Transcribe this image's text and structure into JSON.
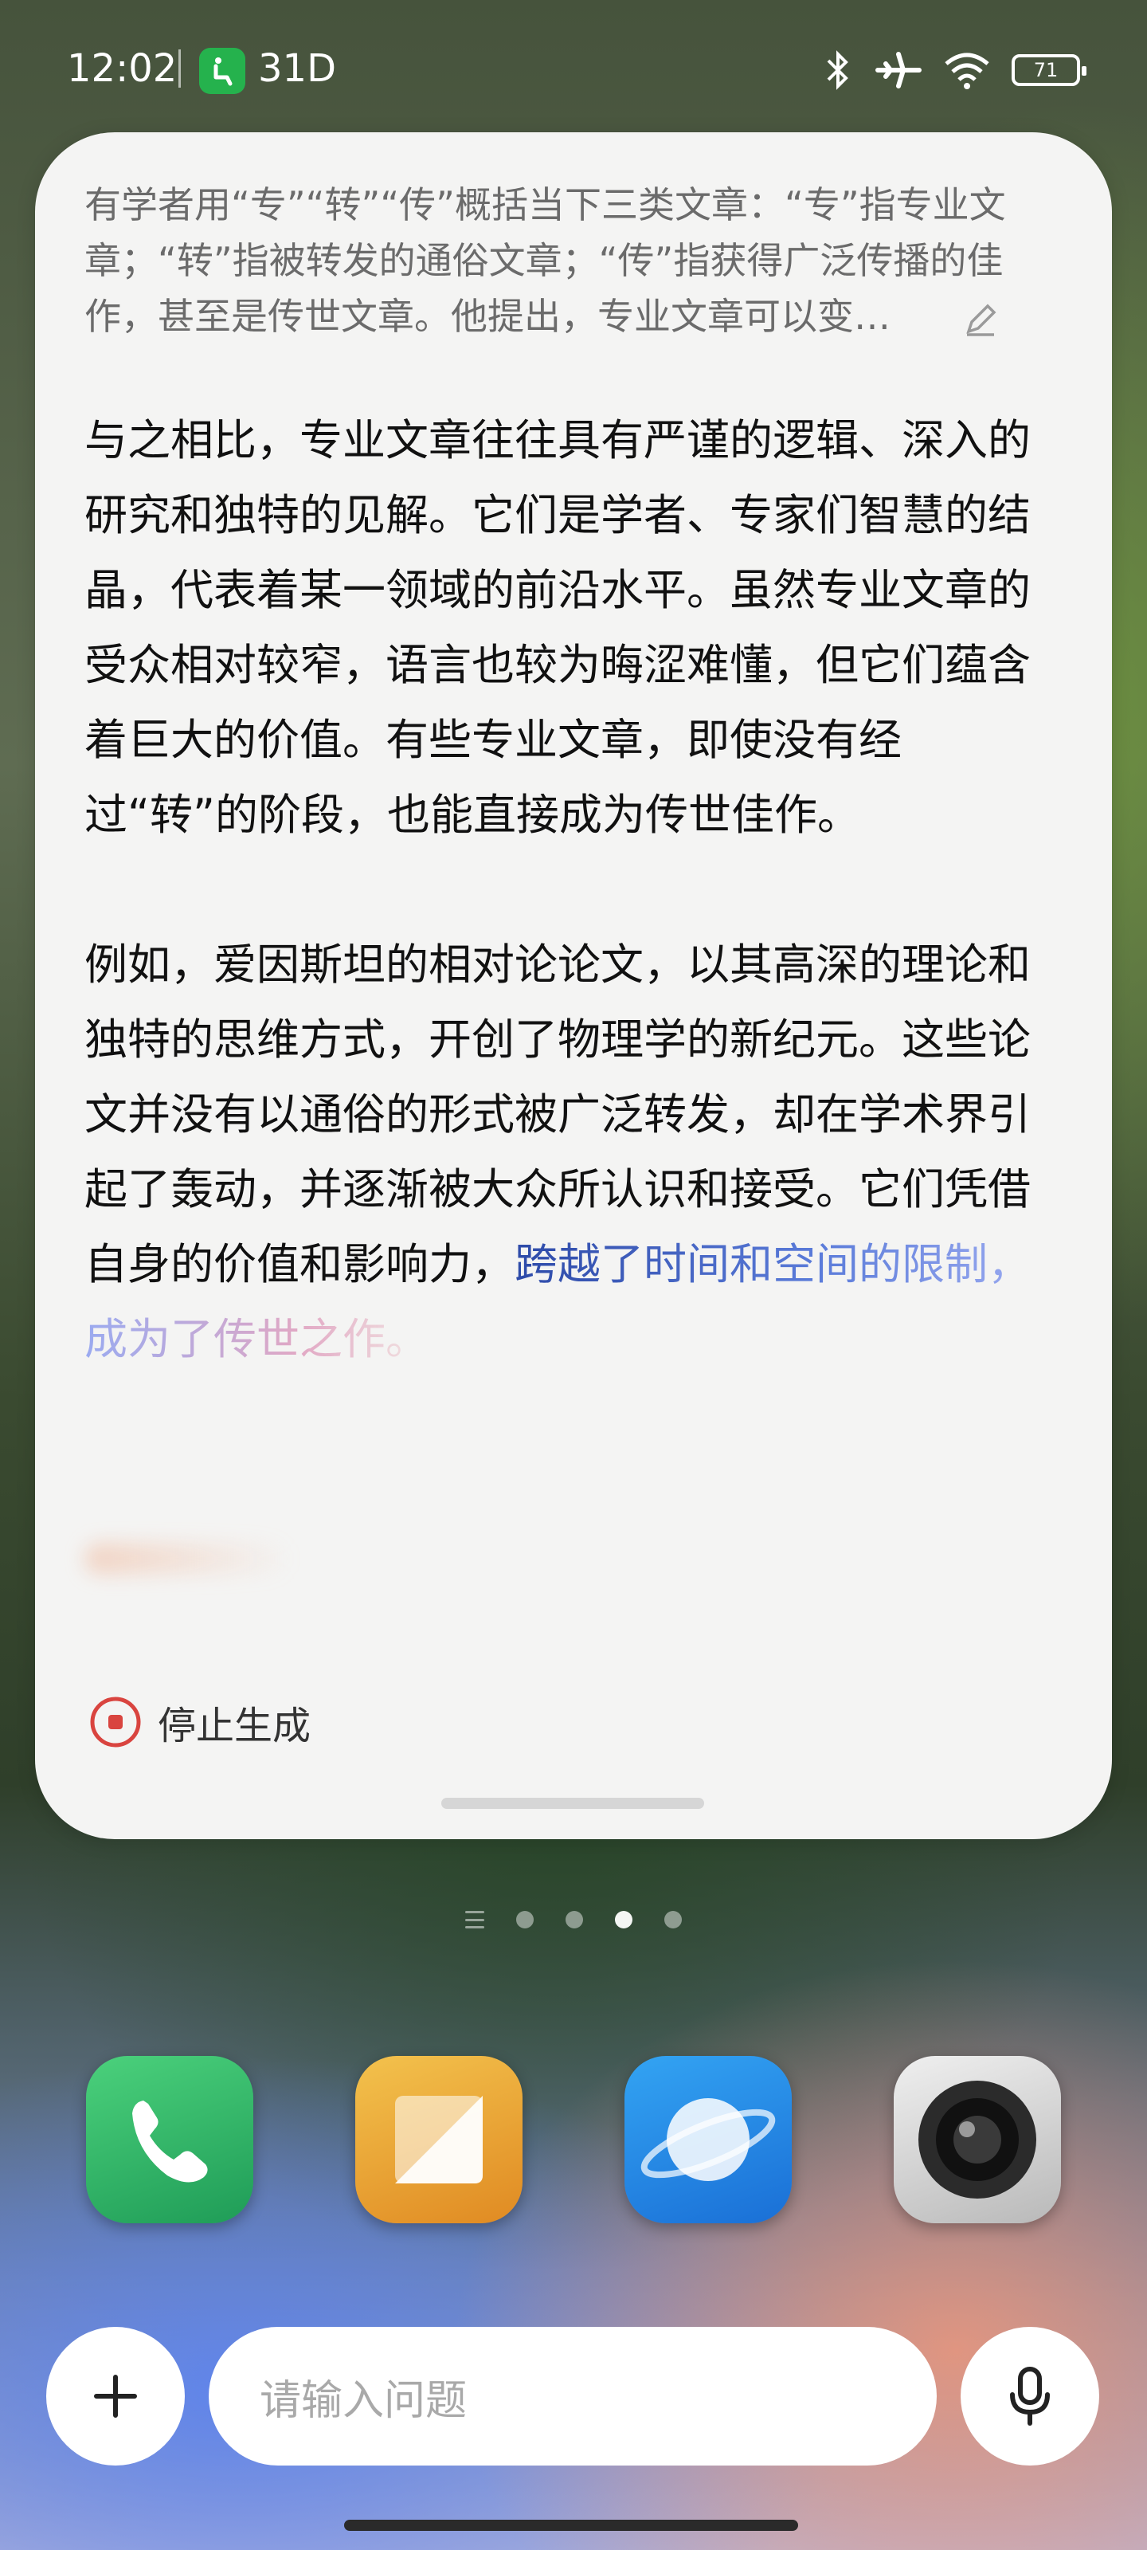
{
  "status": {
    "time": "12:02",
    "badge_text": "31D",
    "battery": "71"
  },
  "card": {
    "prompt": "有学者用“专”“转”“传”概括当下三类文章：“专”指专业文章；“转”指被转发的通俗文章；“传”指获得广泛传播的佳作，甚至是传世文章。他提出，专业文章可以变…",
    "paragraph1": "与之相比，专业文章往往具有严谨的逻辑、深入的研究和独特的见解。它们是学者、专家们智慧的结晶，代表着某一领域的前沿水平。虽然专业文章的受众相对较窄，语言也较为晦涩难懂，但它们蕴含着巨大的价值。有些专业文章，即使没有经过“转”的阶段，也能直接成为传世佳作。",
    "paragraph2_main": "例如，爱因斯坦的相对论论文，以其高深的理论和独特的思维方式，开创了物理学的新纪元。这些论文并没有以通俗的形式被广泛转发，却在学术界引起了轰动，并逐渐被大众所认识和接受。它们凭借自身的价值和影响力，",
    "paragraph2_fading": "跨越了时间和空间的限制，成为了传世之作。",
    "stop_label": "停止生成"
  },
  "pager": {
    "total_pages": 4,
    "active_page": 3
  },
  "dock": {
    "apps": [
      "phone-icon",
      "notes-icon",
      "browser-icon",
      "camera-icon"
    ]
  },
  "input": {
    "placeholder": "请输入问题"
  },
  "colors": {
    "accent": "#2d4aa8",
    "stop": "#d9443f"
  }
}
